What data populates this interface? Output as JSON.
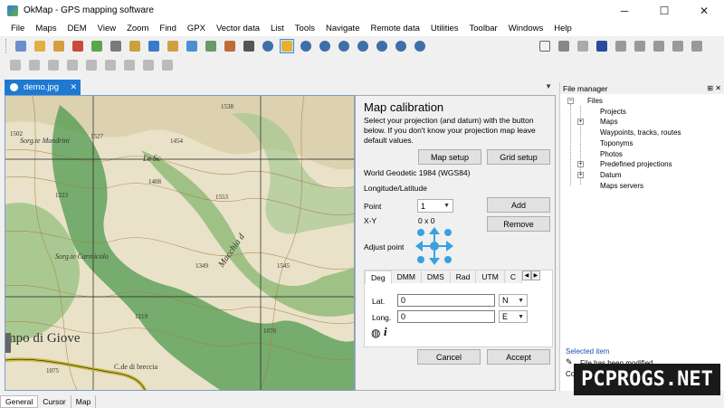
{
  "window": {
    "title": "OkMap - GPS mapping software",
    "minimize": "─",
    "maximize": "☐",
    "close": "✕"
  },
  "menu": [
    "File",
    "Maps",
    "DEM",
    "View",
    "Zoom",
    "Find",
    "GPX",
    "Vector data",
    "List",
    "Tools",
    "Navigate",
    "Remote data",
    "Utilities",
    "Toolbar",
    "Windows",
    "Help"
  ],
  "doc_tab": {
    "label": "demo.jpg",
    "close": "✕"
  },
  "map": {
    "labels": [
      "1502",
      "1538",
      "1454",
      "1527",
      "Sorg.te Mandrini",
      "1223",
      "1408",
      "1553",
      "Sorg.te Carmicolo",
      "1545",
      "1219",
      "1070",
      "mpo di Giove",
      "1075",
      "C.de di breccia",
      "Le Sc",
      "Macchia d",
      "1349"
    ]
  },
  "calibration": {
    "title": "Map calibration",
    "description": "Select your projection (and datum) with the button below. If you don't know your projection map leave default values.",
    "map_setup": "Map setup",
    "grid_setup": "Grid setup",
    "datum": "World Geodetic 1984 (WGS84)",
    "projection": "Longitude/Latitude",
    "point_label": "Point",
    "point_value": "1",
    "add": "Add",
    "xy_label": "X-Y",
    "xy_value": "0 x 0",
    "remove": "Remove",
    "adjust_label": "Adjust point",
    "coord_tabs": [
      "Deg",
      "DMM",
      "DMS",
      "Rad",
      "UTM",
      "C"
    ],
    "lat_label": "Lat.",
    "lat_value": "0",
    "lat_dir": "N",
    "long_label": "Long.",
    "long_value": "0",
    "long_dir": "E",
    "info_icon_text": "i",
    "cancel": "Cancel",
    "accept": "Accept"
  },
  "file_manager": {
    "title": "File manager",
    "pins": "⊞ ✕",
    "root": "Files",
    "items": [
      "Projects",
      "Maps",
      "Waypoints, tracks, routes",
      "Toponyms",
      "Photos",
      "Predefined projections",
      "Datum",
      "Maps servers"
    ],
    "selected_item_label": "Selected item",
    "status_line": "File has been modified",
    "status_line2": "Com"
  },
  "bottom_tabs": [
    "General",
    "Cursor",
    "Map"
  ],
  "watermark": "PCPROGS.NET",
  "colors": {
    "accent": "#1e79d2",
    "map_green": "#4f9a4f",
    "map_paper": "#e9e2c8"
  }
}
